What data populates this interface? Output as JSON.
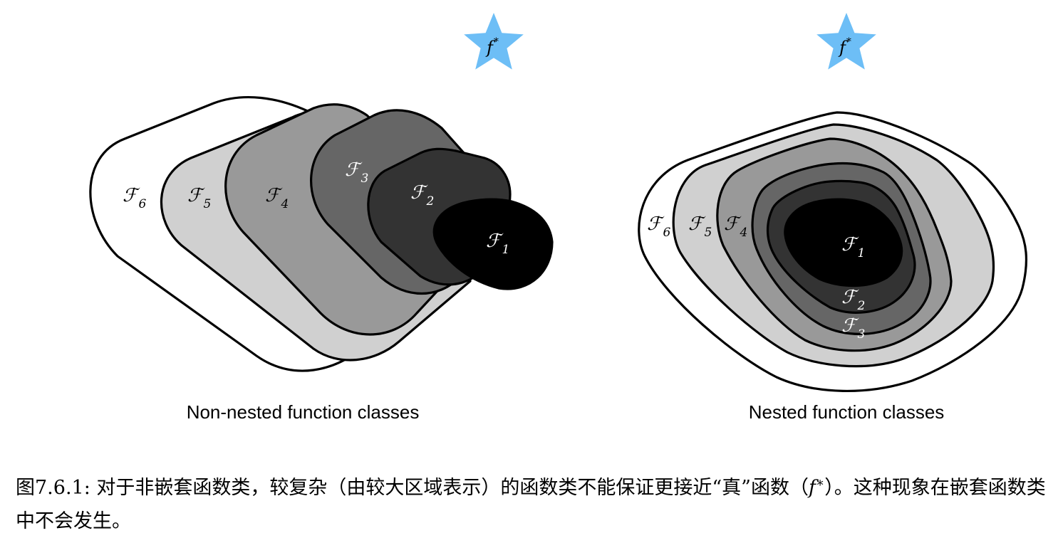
{
  "left_panel": {
    "title": "Non-nested function classes",
    "regions": [
      {
        "symbol": "ℱ",
        "index": "6",
        "fill": "#ffffff",
        "text_color": "#000000"
      },
      {
        "symbol": "ℱ",
        "index": "5",
        "fill": "#d0d0d0",
        "text_color": "#000000"
      },
      {
        "symbol": "ℱ",
        "index": "4",
        "fill": "#999999",
        "text_color": "#000000"
      },
      {
        "symbol": "ℱ",
        "index": "3",
        "fill": "#666666",
        "text_color": "#ffffff"
      },
      {
        "symbol": "ℱ",
        "index": "2",
        "fill": "#333333",
        "text_color": "#ffffff"
      },
      {
        "symbol": "ℱ",
        "index": "1",
        "fill": "#000000",
        "text_color": "#ffffff"
      }
    ],
    "target": {
      "symbol": "f",
      "sup": "*",
      "color": "#6dbef6"
    }
  },
  "right_panel": {
    "title": "Nested function classes",
    "regions": [
      {
        "symbol": "ℱ",
        "index": "6",
        "fill": "#ffffff",
        "text_color": "#000000"
      },
      {
        "symbol": "ℱ",
        "index": "5",
        "fill": "#d0d0d0",
        "text_color": "#000000"
      },
      {
        "symbol": "ℱ",
        "index": "4",
        "fill": "#999999",
        "text_color": "#000000"
      },
      {
        "symbol": "ℱ",
        "index": "3",
        "fill": "#666666",
        "text_color": "#ffffff"
      },
      {
        "symbol": "ℱ",
        "index": "2",
        "fill": "#333333",
        "text_color": "#ffffff"
      },
      {
        "symbol": "ℱ",
        "index": "1",
        "fill": "#000000",
        "text_color": "#ffffff"
      }
    ],
    "target": {
      "symbol": "f",
      "sup": "*",
      "color": "#6dbef6"
    }
  },
  "caption": {
    "prefix": "图7.6.1: 对于非嵌套函数类，较复杂（由较大区域表示）的函数类不能保证更接近“真”函数（",
    "symbol": "f",
    "sup": "∗",
    "suffix": "）。这种现象在嵌套函数类中不会发生。"
  }
}
